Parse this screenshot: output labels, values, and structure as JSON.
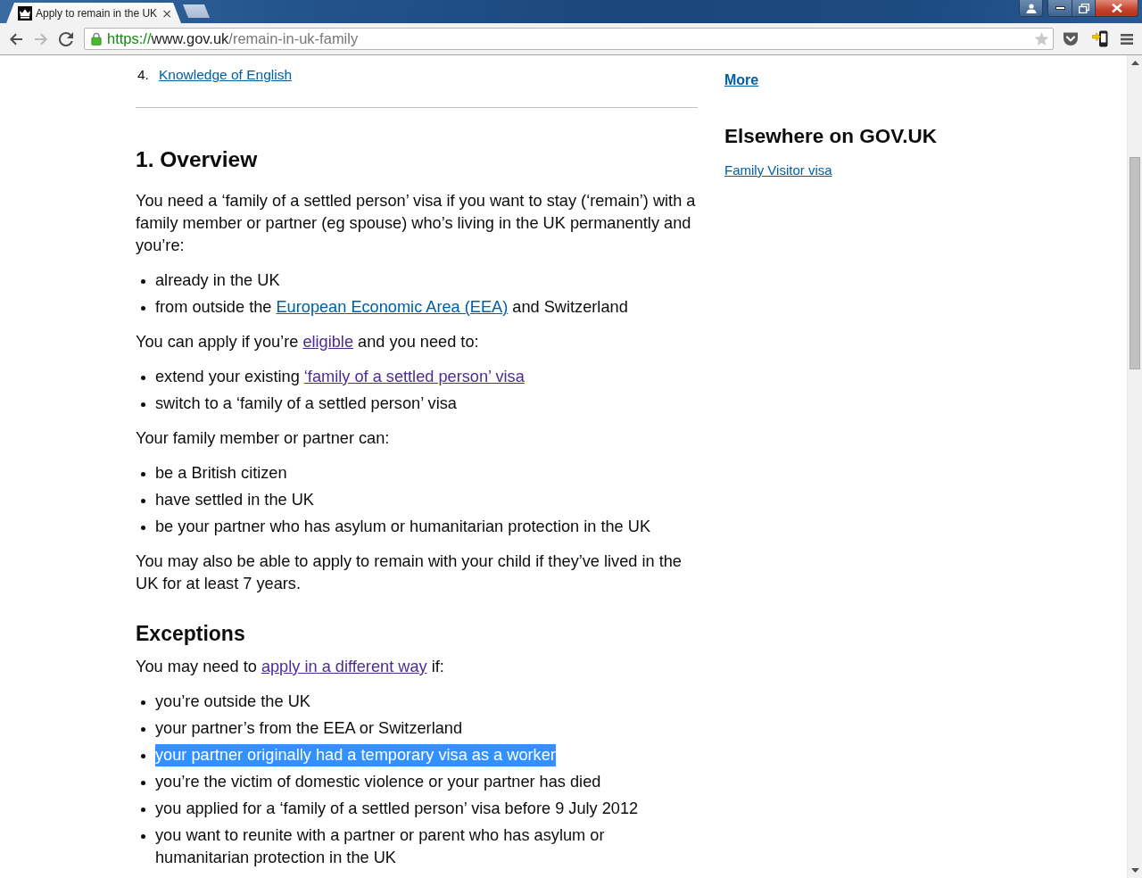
{
  "browser": {
    "tabs": [
      {
        "title": "Apply to remain in the UK",
        "close": "×",
        "selected": true
      }
    ],
    "nav_buttons": [
      {
        "kind": "back",
        "disabled": false
      },
      {
        "kind": "forward",
        "disabled": true
      },
      {
        "kind": "reload",
        "disabled": false
      }
    ],
    "address": {
      "scheme": "https://",
      "host": "www.gov.uk",
      "path": "/remain-in-uk-family"
    }
  },
  "contents_list": [
    {
      "number": "4.",
      "label": "Knowledge of English",
      "visited": false
    }
  ],
  "blocks": [
    {
      "kind": "heading",
      "text": "1. Overview"
    },
    {
      "kind": "paragraph",
      "segments": [
        {
          "kind": "text",
          "text": "You need a ‘family of a settled person’ visa if you want to stay (‘remain’) with a family member or partner (eg spouse) who’s living in the UK permanently and you’re:"
        }
      ]
    },
    {
      "kind": "bullets",
      "items": [
        {
          "segments": [
            {
              "kind": "text",
              "text": "already in the UK"
            }
          ]
        },
        {
          "segments": [
            {
              "kind": "text",
              "text": "from outside the "
            },
            {
              "kind": "link",
              "text": "European Economic Area (EEA)",
              "visited": false
            },
            {
              "kind": "text",
              "text": " and Switzerland"
            }
          ]
        }
      ]
    },
    {
      "kind": "paragraph",
      "segments": [
        {
          "kind": "text",
          "text": "You can apply if you’re "
        },
        {
          "kind": "link",
          "text": "eligible",
          "visited": true
        },
        {
          "kind": "text",
          "text": " and you need to:"
        }
      ]
    },
    {
      "kind": "bullets",
      "items": [
        {
          "segments": [
            {
              "kind": "text",
              "text": "extend your existing "
            },
            {
              "kind": "link",
              "text": "‘family of a settled person’ visa",
              "visited": true
            }
          ]
        },
        {
          "segments": [
            {
              "kind": "text",
              "text": "switch to a ‘family of a settled person’ visa"
            }
          ]
        }
      ]
    },
    {
      "kind": "paragraph",
      "segments": [
        {
          "kind": "text",
          "text": "Your family member or partner can:"
        }
      ]
    },
    {
      "kind": "bullets",
      "items": [
        {
          "segments": [
            {
              "kind": "text",
              "text": "be a British citizen"
            }
          ]
        },
        {
          "segments": [
            {
              "kind": "text",
              "text": "have settled in the UK"
            }
          ]
        },
        {
          "segments": [
            {
              "kind": "text",
              "text": "be your partner who has asylum or humanitarian protection in the UK"
            }
          ]
        }
      ]
    },
    {
      "kind": "paragraph",
      "segments": [
        {
          "kind": "text",
          "text": "You may also be able to apply to remain with your child if they’ve lived in the UK for at least 7 years."
        }
      ]
    },
    {
      "kind": "subheading",
      "text": "Exceptions"
    },
    {
      "kind": "paragraph",
      "segments": [
        {
          "kind": "text",
          "text": "You may need to "
        },
        {
          "kind": "link",
          "text": "apply in a different way",
          "visited": true
        },
        {
          "kind": "text",
          "text": " if:"
        }
      ]
    },
    {
      "kind": "bullets",
      "items": [
        {
          "highlighted": false,
          "segments": [
            {
              "kind": "text",
              "text": "you’re outside the UK"
            }
          ]
        },
        {
          "highlighted": false,
          "segments": [
            {
              "kind": "text",
              "text": "your partner’s from the EEA or Switzerland"
            }
          ]
        },
        {
          "highlighted": true,
          "segments": [
            {
              "kind": "text",
              "text": "your partner originally had a temporary visa as a worker"
            }
          ]
        },
        {
          "highlighted": false,
          "segments": [
            {
              "kind": "text",
              "text": "you’re the victim of domestic violence or your partner has died"
            }
          ]
        },
        {
          "highlighted": false,
          "segments": [
            {
              "kind": "text",
              "text": "you applied for a ‘family of a settled person’ visa before 9 July 2012"
            }
          ]
        },
        {
          "highlighted": false,
          "segments": [
            {
              "kind": "text",
              "text": "you want to reunite with a partner or parent who has asylum or humanitarian protection in the UK"
            }
          ]
        }
      ]
    }
  ],
  "sidebar": {
    "more": {
      "text": "More",
      "visited": false
    },
    "heading": "Elsewhere on GOV.UK",
    "links": [
      {
        "text": "Family Visitor visa",
        "visited": false
      }
    ]
  }
}
